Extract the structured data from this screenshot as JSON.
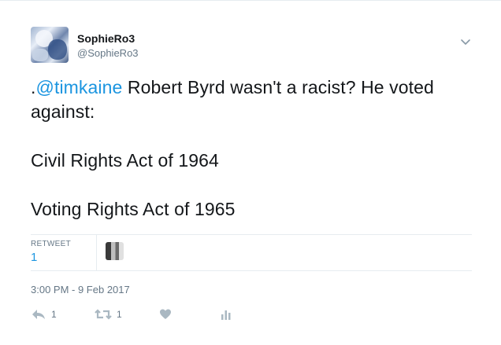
{
  "user": {
    "display_name": "SophieRo3",
    "handle": "@SophieRo3"
  },
  "tweet": {
    "prefix": ".",
    "mention": "@timkaine",
    "line1_rest": " Robert Byrd wasn't a racist? He voted against:",
    "line2": "Civil Rights Act of 1964",
    "line3": "Voting Rights Act of 1965"
  },
  "stats": {
    "retweet_label": "RETWEET",
    "retweet_count": "1"
  },
  "timestamp": "3:00 PM - 9 Feb 2017",
  "actions": {
    "reply_count": "1",
    "retweet_count": "1"
  },
  "colors": {
    "link": "#1b95e0",
    "muted": "#657786",
    "divider": "#e6ecf0"
  }
}
